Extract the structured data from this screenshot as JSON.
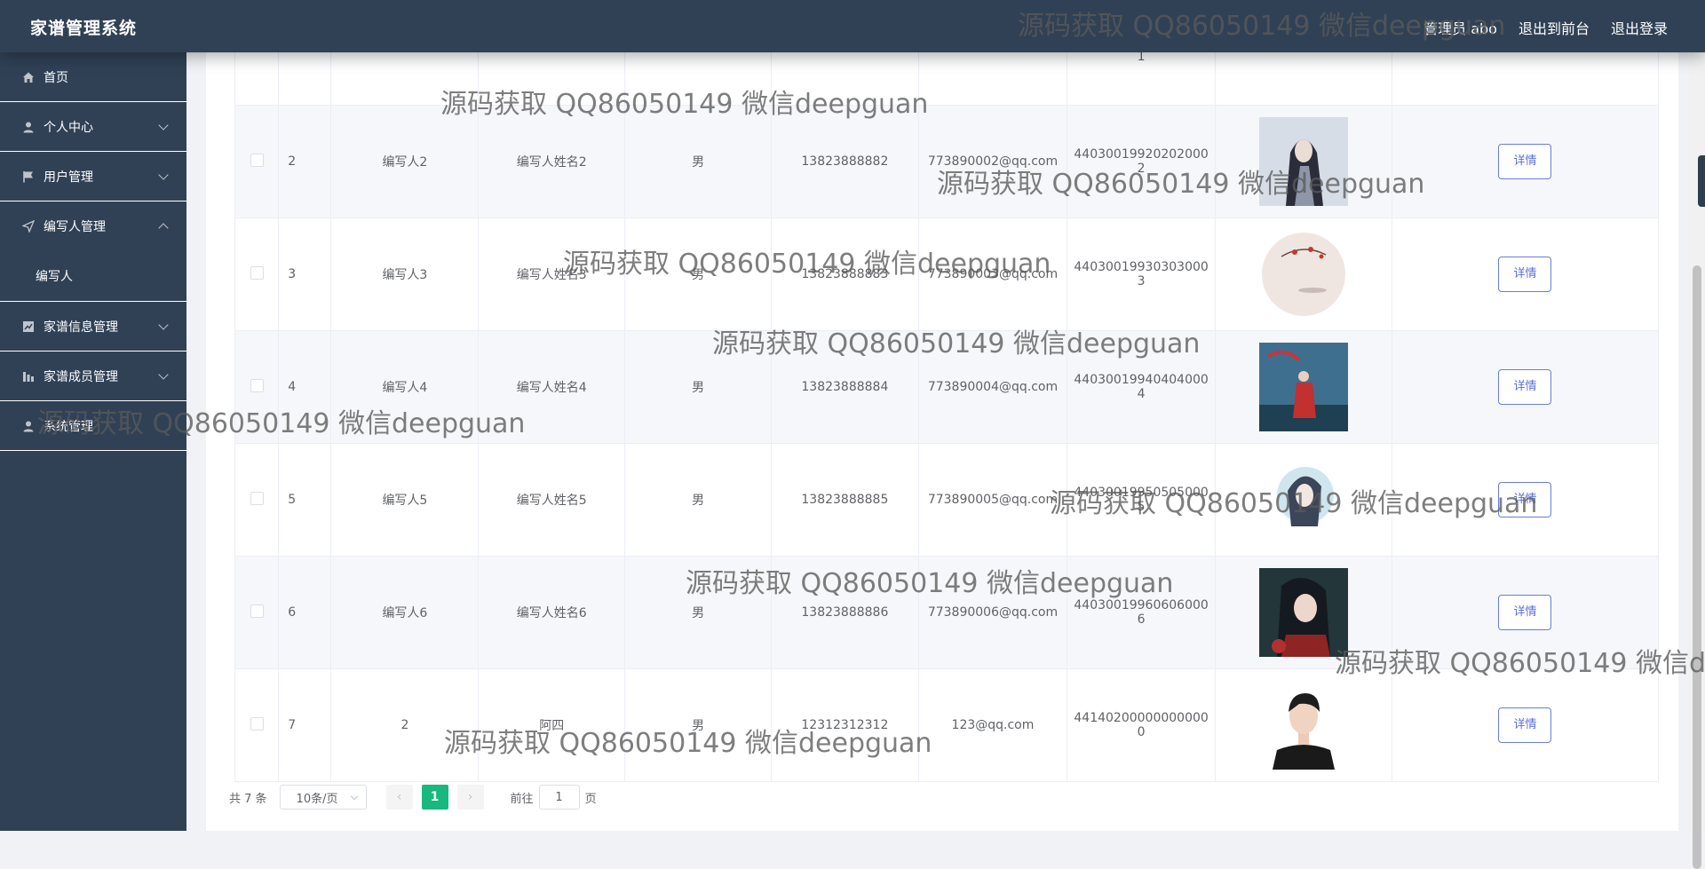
{
  "app": {
    "title": "家谱管理系统"
  },
  "topnav": {
    "admin": "管理员 abo",
    "frontend": "退出到前台",
    "logout": "退出登录"
  },
  "sidebar": {
    "items": [
      {
        "label": "首页",
        "icon": "home-icon"
      },
      {
        "label": "个人中心",
        "icon": "user-icon"
      },
      {
        "label": "用户管理",
        "icon": "flag-icon"
      },
      {
        "label": "编写人管理",
        "icon": "send-icon"
      },
      {
        "label": "编写人",
        "icon": ""
      },
      {
        "label": "家谱信息管理",
        "icon": "chart-icon"
      },
      {
        "label": "家谱成员管理",
        "icon": "bars-icon"
      },
      {
        "label": "系统管理",
        "icon": "user-icon"
      }
    ]
  },
  "table": {
    "top_partial": {
      "idcard_tail": "1"
    },
    "rows": [
      {
        "idx": "2",
        "account": "编写人2",
        "name": "编写人姓名2",
        "gender": "男",
        "phone": "13823888882",
        "email": "773890002@qq.com",
        "idcard1": "44030019920202000",
        "idcard2": "2",
        "detail": "详情"
      },
      {
        "idx": "3",
        "account": "编写人3",
        "name": "编写人姓名3",
        "gender": "男",
        "phone": "13823888883",
        "email": "773890003@qq.com",
        "idcard1": "44030019930303000",
        "idcard2": "3",
        "detail": "详情"
      },
      {
        "idx": "4",
        "account": "编写人4",
        "name": "编写人姓名4",
        "gender": "男",
        "phone": "13823888884",
        "email": "773890004@qq.com",
        "idcard1": "44030019940404000",
        "idcard2": "4",
        "detail": "详情"
      },
      {
        "idx": "5",
        "account": "编写人5",
        "name": "编写人姓名5",
        "gender": "男",
        "phone": "13823888885",
        "email": "773890005@qq.com",
        "idcard1": "44030019950505000",
        "idcard2": "5",
        "detail": "详情"
      },
      {
        "idx": "6",
        "account": "编写人6",
        "name": "编写人姓名6",
        "gender": "男",
        "phone": "13823888886",
        "email": "773890006@qq.com",
        "idcard1": "44030019960606000",
        "idcard2": "6",
        "detail": "详情"
      },
      {
        "idx": "7",
        "account": "2",
        "name": "阿四",
        "gender": "男",
        "phone": "12312312312",
        "email": "123@qq.com",
        "idcard1": "44140200000000000",
        "idcard2": "0",
        "detail": "详情"
      }
    ]
  },
  "pagination": {
    "total": "共 7 条",
    "page_size": "10条/页",
    "prev": "‹",
    "current": "1",
    "next": "›",
    "goto_label": "前往",
    "goto_value": "1",
    "goto_unit": "页"
  },
  "watermark": "源码获取 QQ86050149 微信deepguan",
  "colors": {
    "sidebar": "#304156",
    "accent": "#18b87e",
    "button_border": "#6a7dd8"
  }
}
